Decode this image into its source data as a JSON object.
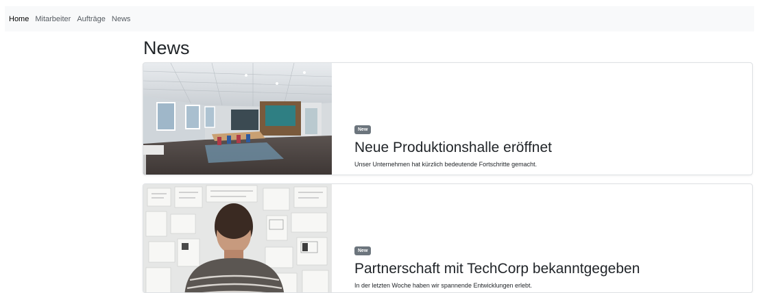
{
  "nav": {
    "items": [
      {
        "label": "Home",
        "active": true
      },
      {
        "label": "Mitarbeiter",
        "active": false
      },
      {
        "label": "Aufträge",
        "active": false
      },
      {
        "label": "News",
        "active": false
      }
    ]
  },
  "page": {
    "title": "News"
  },
  "news": [
    {
      "badge": "New",
      "title": "Neue Produktionshalle eröffnet",
      "text": "Unser Unternehmen hat kürzlich bedeutende Fortschritte gemacht."
    },
    {
      "badge": "New",
      "title": "Partnerschaft mit TechCorp bekanntgegeben",
      "text": "In der letzten Woche haben wir spannende Entwicklungen erlebt."
    }
  ],
  "colors": {
    "navbar_bg": "#f8f9fa",
    "badge_bg": "#6c757d",
    "card_border": "#dde0e3"
  }
}
